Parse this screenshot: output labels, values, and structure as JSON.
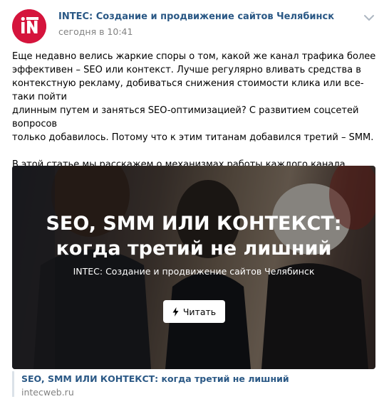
{
  "post": {
    "author": "INTEC: Создание и продвижение сайтов Челябинск",
    "time": "сегодня в 10:41",
    "paragraphs": [
      "Еще недавно велись жаркие споры о том, какой же канал трафика более\nэффективен – SEO или контекст. Лучше регулярно вливать средства в\nконтекстную рекламу, добиваться снижения стоимости клика или все-таки пойти\nдлинным путем и заняться SEO-оптимизацией? С развитием соцсетей вопросов\nтолько добавилось. Потому что к этим титанам добавился третий – SMM.",
      "В этой статье мы расскажем о механизмах работы каждого канала продвижения,\nплюсах и минусах."
    ]
  },
  "card": {
    "title": "SEO, SMM ИЛИ КОНТЕКСТ: когда третий не лишний",
    "source": "INTEC: Создание и продвижение сайтов Челябинск",
    "button_label": "Читать"
  },
  "snippet": {
    "title": "SEO, SMM ИЛИ КОНТЕКСТ: когда третий не лишний",
    "domain": "intecweb.ru"
  },
  "colors": {
    "link": "#2a5885",
    "muted": "#828282",
    "avatar_brand": "#d5143c"
  },
  "icons": {
    "avatar_logo": "intec-logo",
    "menu": "chevron-down-icon",
    "button": "bolt-icon"
  }
}
